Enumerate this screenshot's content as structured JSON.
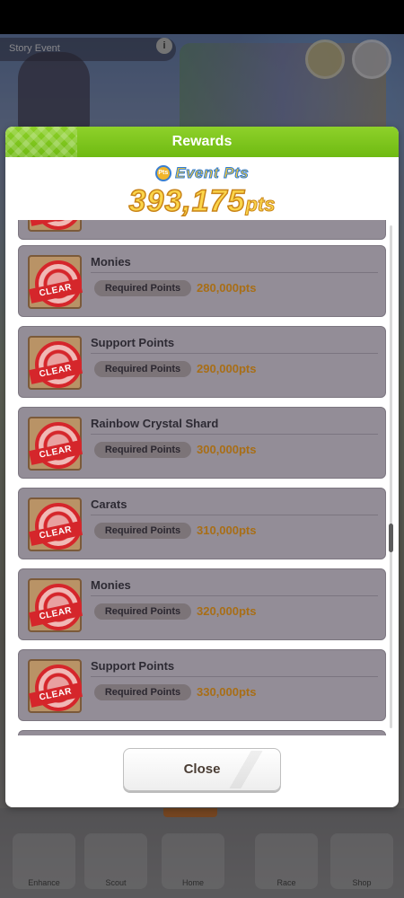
{
  "background": {
    "story_tab_label": "Story Event",
    "info_icon": "info-icon"
  },
  "bottom_nav": {
    "items": [
      {
        "label": "Enhance",
        "icon": "character-icon"
      },
      {
        "label": "Scout",
        "icon": "scout-icon"
      },
      {
        "label": "Home",
        "icon": "home-icon"
      },
      {
        "label": "Race",
        "icon": "race-icon"
      },
      {
        "label": "Shop",
        "icon": "shop-icon"
      }
    ]
  },
  "dialog": {
    "title": "Rewards",
    "event_pts_label": "Event Pts",
    "event_pts_icon_text": "Pts",
    "event_pts_value": "393,175",
    "event_pts_unit": "pts",
    "close_label": "Close"
  },
  "rewards": {
    "stamp_text": "CLEAR",
    "required_label": "Required Points",
    "items": [
      {
        "name": "Monies",
        "required": "280,000pts"
      },
      {
        "name": "Support Points",
        "required": "290,000pts"
      },
      {
        "name": "Rainbow Crystal Shard",
        "required": "300,000pts"
      },
      {
        "name": "Carats",
        "required": "310,000pts"
      },
      {
        "name": "Monies",
        "required": "320,000pts"
      },
      {
        "name": "Support Points",
        "required": "330,000pts"
      }
    ]
  },
  "colors": {
    "header_green": "#7ec51f",
    "row_gray": "#938d97",
    "points_gold": "#a86e16",
    "stamp_red": "#d5262b"
  }
}
